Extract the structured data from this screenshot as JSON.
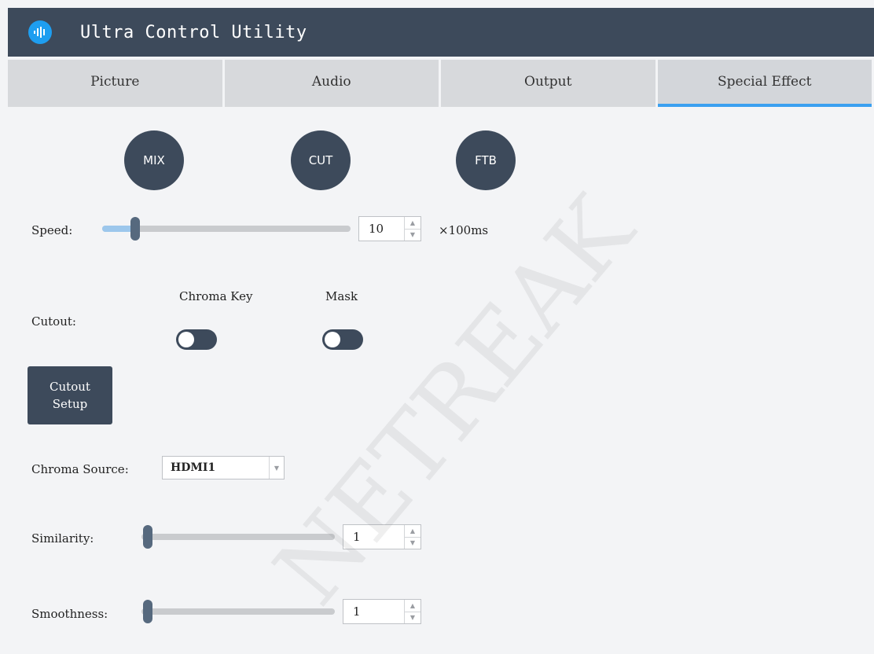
{
  "window": {
    "title": "Ultra Control Utility"
  },
  "tabs": [
    {
      "label": "Picture",
      "active": false
    },
    {
      "label": "Audio",
      "active": false
    },
    {
      "label": "Output",
      "active": false
    },
    {
      "label": "Special Effect",
      "active": true
    }
  ],
  "transitions": {
    "mix": "MIX",
    "cut": "CUT",
    "ftb": "FTB"
  },
  "speed": {
    "label": "Speed:",
    "value": "10",
    "unit": "×100ms",
    "level": 0.03
  },
  "cutout": {
    "label": "Cutout:",
    "chroma_key": {
      "label": "Chroma Key",
      "on": false
    },
    "mask": {
      "label": "Mask",
      "on": false
    },
    "setup_button": "Cutout Setup"
  },
  "chroma_source": {
    "label": "Chroma Source:",
    "value": "HDMI1"
  },
  "similarity": {
    "label": "Similarity:",
    "value": "1",
    "level": 0.0
  },
  "smoothness": {
    "label": "Smoothness:",
    "value": "1",
    "level": 0.0
  },
  "watermark": "NETREAK",
  "colors": {
    "header": "#3d4a5b",
    "accent": "#3aa0f0",
    "logo": "#1e9ef0"
  },
  "icons": {
    "logo": "waveform-logo-icon",
    "spin": "spin-arrows-icon",
    "dropdown": "dropdown-arrow-icon"
  }
}
